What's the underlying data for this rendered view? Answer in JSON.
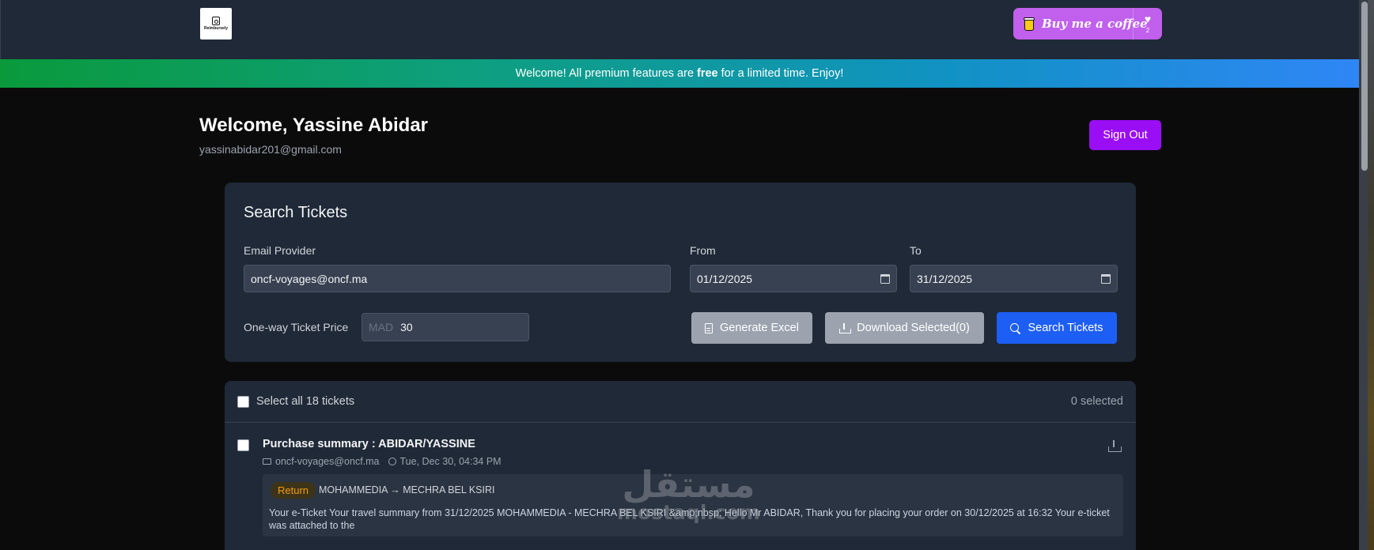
{
  "header": {
    "logo_text": "Reimbursely",
    "coffee_label": "Buy me a coffee",
    "coffee_count": "2"
  },
  "banner": {
    "text_before": "Welcome! All premium features are",
    "text_bold": "free",
    "text_after": "for a limited time. Enjoy!"
  },
  "user": {
    "welcome": "Welcome, Yassine Abidar",
    "email": "yassinabidar201@gmail.com",
    "sign_out_label": "Sign Out"
  },
  "search": {
    "title": "Search Tickets",
    "email_provider_label": "Email Provider",
    "email_provider_value": "oncf-voyages@oncf.ma",
    "from_label": "From",
    "from_value": "01/12/2025",
    "to_label": "To",
    "to_value": "31/12/2025",
    "price_label": "One-way Ticket Price",
    "price_prefix": "MAD",
    "price_value": "30",
    "generate_excel_label": "Generate Excel",
    "download_selected_label": "Download Selected(0)",
    "search_button_label": "Search Tickets"
  },
  "results": {
    "select_all_label": "Select all 18 tickets",
    "selected_count": "0 selected",
    "tickets": [
      {
        "title": "Purchase summary : ABIDAR/YASSINE",
        "sender": "oncf-voyages@oncf.ma",
        "date": "Tue, Dec 30, 04:34 PM",
        "badge": "Return",
        "route": "MOHAMMEDIA → MECHRA BEL KSIRI",
        "snippet": "Your e-Ticket Your travel summary from 31/12/2025 MOHAMMEDIA - MECHRA BEL KSIRI &amp;nbsp; Hello Mr ABIDAR, Thank you for placing your order on 30/12/2025 at 16:32 Your e-ticket was attached to the"
      }
    ]
  },
  "watermark": {
    "arabic": "مستقل",
    "latin": "mostaql.com"
  },
  "colors": {
    "accent_purple": "#9a0ef5",
    "primary_blue": "#1d5ef5",
    "badge_amber": "#f59e0b"
  }
}
